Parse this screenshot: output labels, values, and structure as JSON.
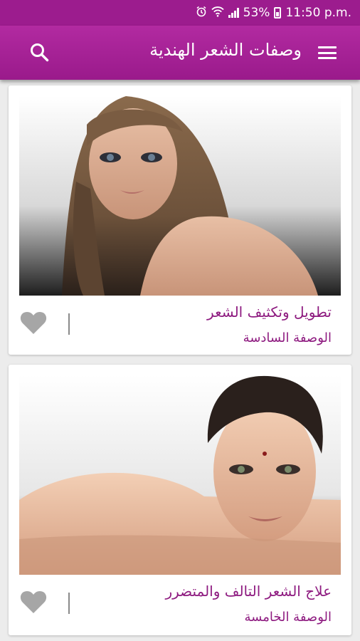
{
  "status_bar": {
    "battery_percent": "53%",
    "time": "11:50 p.m.",
    "icons": [
      "alarm-icon",
      "wifi-icon",
      "signal-icon",
      "battery-icon"
    ]
  },
  "app_bar": {
    "title": "وصفات الشعر الهندية",
    "search_icon": "search-icon",
    "menu_icon": "hamburger-menu-icon"
  },
  "colors": {
    "primary": "#9c1c8e",
    "accent_text": "#8e1b80",
    "heart": "#a6a6a6"
  },
  "cards": [
    {
      "title": "تطويل وتكثيف الشعر",
      "subtitle": "الوصفة السادسة",
      "image": "woman-long-straight-hair-photo",
      "favorite_icon": "heart-icon"
    },
    {
      "title": "علاج الشعر التالف والمتضرر",
      "subtitle": "الوصفة الخامسة",
      "image": "woman-hair-pulled-back-photo",
      "favorite_icon": "heart-icon"
    }
  ]
}
